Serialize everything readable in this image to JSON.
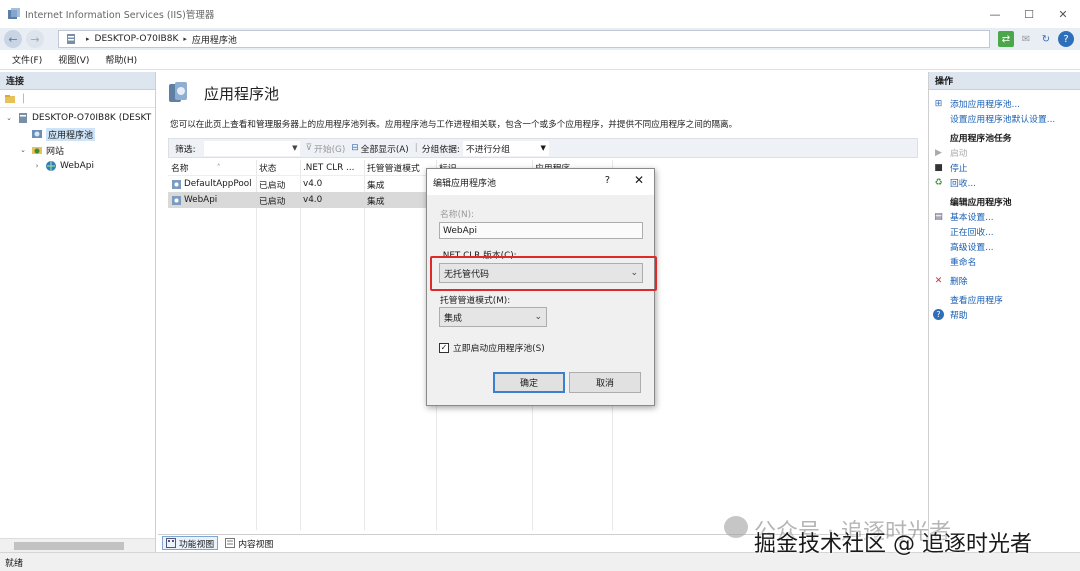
{
  "window": {
    "title": "Internet Information Services (IIS)管理器",
    "controls": {
      "minimize": "—",
      "maximize": "☐",
      "close": "✕"
    }
  },
  "address_bar": {
    "crumbs": [
      "DESKTOP-O70IB8K",
      "应用程序池"
    ],
    "separator": "▸"
  },
  "menu": {
    "items": [
      "文件(F)",
      "视图(V)",
      "帮助(H)"
    ]
  },
  "connections": {
    "header": "连接",
    "tree": [
      {
        "label": "DESKTOP-O70IB8K (DESKT",
        "expander": "⌄",
        "level": 0
      },
      {
        "label": "应用程序池",
        "expander": "",
        "level": 1
      },
      {
        "label": "网站",
        "expander": "⌄",
        "level": 1
      },
      {
        "label": "WebApi",
        "expander": "›",
        "level": 2
      }
    ]
  },
  "main": {
    "title": "应用程序池",
    "description": "您可以在此页上查看和管理服务器上的应用程序池列表。应用程序池与工作进程相关联，包含一个或多个应用程序，并提供不同应用程序之间的隔离。",
    "filter": {
      "label": "筛选:",
      "start_label": "开始(G)",
      "show_all_label": "全部显示(A)",
      "group_label": "分组依据:",
      "group_value": "不进行分组"
    },
    "columns": [
      "名称",
      "状态",
      ".NET CLR ...",
      "托管管道模式",
      "标识",
      "应用程序..."
    ],
    "rows": [
      {
        "name": "DefaultAppPool",
        "status": "已启动",
        "clr": "v4.0",
        "mode": "集成",
        "identity": "",
        "apps": ""
      },
      {
        "name": "WebApi",
        "status": "已启动",
        "clr": "v4.0",
        "mode": "集成",
        "identity": "",
        "apps": ""
      }
    ],
    "view_tabs": [
      "功能视图",
      "内容视图"
    ]
  },
  "actions": {
    "header": "操作",
    "top_links": [
      "添加应用程序池...",
      "设置应用程序池默认设置..."
    ],
    "section_tasks": "应用程序池任务",
    "task_links": [
      "启动",
      "停止",
      "回收..."
    ],
    "section_edit": "编辑应用程序池",
    "edit_links": [
      "基本设置...",
      "正在回收...",
      "高级设置...",
      "重命名"
    ],
    "delete_link": "删除",
    "view_link": "查看应用程序",
    "help_link": "帮助"
  },
  "status_bar": {
    "text": "就绪"
  },
  "dialog": {
    "title": "编辑应用程序池",
    "help": "?",
    "close": "✕",
    "name_label": "名称(N):",
    "name_value": "WebApi",
    "clr_label": ".NET CLR 版本(C):",
    "clr_value": "无托管代码",
    "pipeline_label": "托管管道模式(M):",
    "pipeline_value": "集成",
    "autostart_label": "立即启动应用程序池(S)",
    "autostart_checked": true,
    "ok_label": "确定",
    "cancel_label": "取消"
  },
  "watermark": {
    "line1": "公众号 · 追逐时光者",
    "line2": "掘金技术社区 @ 追逐时光者"
  },
  "colors": {
    "highlight": "#e02a2a",
    "link": "#1a5fb4",
    "selection": "#cde3f7"
  }
}
